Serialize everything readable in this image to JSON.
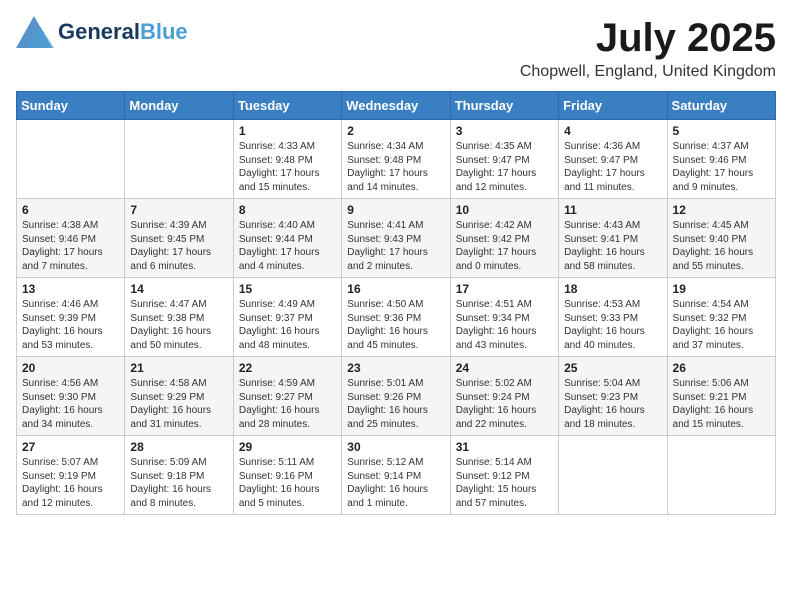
{
  "header": {
    "logo_general": "General",
    "logo_blue": "Blue",
    "month_title": "July 2025",
    "location": "Chopwell, England, United Kingdom"
  },
  "weekdays": [
    "Sunday",
    "Monday",
    "Tuesday",
    "Wednesday",
    "Thursday",
    "Friday",
    "Saturday"
  ],
  "rows": [
    [
      {
        "day": "",
        "sunrise": "",
        "sunset": "",
        "daylight": ""
      },
      {
        "day": "",
        "sunrise": "",
        "sunset": "",
        "daylight": ""
      },
      {
        "day": "1",
        "sunrise": "Sunrise: 4:33 AM",
        "sunset": "Sunset: 9:48 PM",
        "daylight": "Daylight: 17 hours and 15 minutes."
      },
      {
        "day": "2",
        "sunrise": "Sunrise: 4:34 AM",
        "sunset": "Sunset: 9:48 PM",
        "daylight": "Daylight: 17 hours and 14 minutes."
      },
      {
        "day": "3",
        "sunrise": "Sunrise: 4:35 AM",
        "sunset": "Sunset: 9:47 PM",
        "daylight": "Daylight: 17 hours and 12 minutes."
      },
      {
        "day": "4",
        "sunrise": "Sunrise: 4:36 AM",
        "sunset": "Sunset: 9:47 PM",
        "daylight": "Daylight: 17 hours and 11 minutes."
      },
      {
        "day": "5",
        "sunrise": "Sunrise: 4:37 AM",
        "sunset": "Sunset: 9:46 PM",
        "daylight": "Daylight: 17 hours and 9 minutes."
      }
    ],
    [
      {
        "day": "6",
        "sunrise": "Sunrise: 4:38 AM",
        "sunset": "Sunset: 9:46 PM",
        "daylight": "Daylight: 17 hours and 7 minutes."
      },
      {
        "day": "7",
        "sunrise": "Sunrise: 4:39 AM",
        "sunset": "Sunset: 9:45 PM",
        "daylight": "Daylight: 17 hours and 6 minutes."
      },
      {
        "day": "8",
        "sunrise": "Sunrise: 4:40 AM",
        "sunset": "Sunset: 9:44 PM",
        "daylight": "Daylight: 17 hours and 4 minutes."
      },
      {
        "day": "9",
        "sunrise": "Sunrise: 4:41 AM",
        "sunset": "Sunset: 9:43 PM",
        "daylight": "Daylight: 17 hours and 2 minutes."
      },
      {
        "day": "10",
        "sunrise": "Sunrise: 4:42 AM",
        "sunset": "Sunset: 9:42 PM",
        "daylight": "Daylight: 17 hours and 0 minutes."
      },
      {
        "day": "11",
        "sunrise": "Sunrise: 4:43 AM",
        "sunset": "Sunset: 9:41 PM",
        "daylight": "Daylight: 16 hours and 58 minutes."
      },
      {
        "day": "12",
        "sunrise": "Sunrise: 4:45 AM",
        "sunset": "Sunset: 9:40 PM",
        "daylight": "Daylight: 16 hours and 55 minutes."
      }
    ],
    [
      {
        "day": "13",
        "sunrise": "Sunrise: 4:46 AM",
        "sunset": "Sunset: 9:39 PM",
        "daylight": "Daylight: 16 hours and 53 minutes."
      },
      {
        "day": "14",
        "sunrise": "Sunrise: 4:47 AM",
        "sunset": "Sunset: 9:38 PM",
        "daylight": "Daylight: 16 hours and 50 minutes."
      },
      {
        "day": "15",
        "sunrise": "Sunrise: 4:49 AM",
        "sunset": "Sunset: 9:37 PM",
        "daylight": "Daylight: 16 hours and 48 minutes."
      },
      {
        "day": "16",
        "sunrise": "Sunrise: 4:50 AM",
        "sunset": "Sunset: 9:36 PM",
        "daylight": "Daylight: 16 hours and 45 minutes."
      },
      {
        "day": "17",
        "sunrise": "Sunrise: 4:51 AM",
        "sunset": "Sunset: 9:34 PM",
        "daylight": "Daylight: 16 hours and 43 minutes."
      },
      {
        "day": "18",
        "sunrise": "Sunrise: 4:53 AM",
        "sunset": "Sunset: 9:33 PM",
        "daylight": "Daylight: 16 hours and 40 minutes."
      },
      {
        "day": "19",
        "sunrise": "Sunrise: 4:54 AM",
        "sunset": "Sunset: 9:32 PM",
        "daylight": "Daylight: 16 hours and 37 minutes."
      }
    ],
    [
      {
        "day": "20",
        "sunrise": "Sunrise: 4:56 AM",
        "sunset": "Sunset: 9:30 PM",
        "daylight": "Daylight: 16 hours and 34 minutes."
      },
      {
        "day": "21",
        "sunrise": "Sunrise: 4:58 AM",
        "sunset": "Sunset: 9:29 PM",
        "daylight": "Daylight: 16 hours and 31 minutes."
      },
      {
        "day": "22",
        "sunrise": "Sunrise: 4:59 AM",
        "sunset": "Sunset: 9:27 PM",
        "daylight": "Daylight: 16 hours and 28 minutes."
      },
      {
        "day": "23",
        "sunrise": "Sunrise: 5:01 AM",
        "sunset": "Sunset: 9:26 PM",
        "daylight": "Daylight: 16 hours and 25 minutes."
      },
      {
        "day": "24",
        "sunrise": "Sunrise: 5:02 AM",
        "sunset": "Sunset: 9:24 PM",
        "daylight": "Daylight: 16 hours and 22 minutes."
      },
      {
        "day": "25",
        "sunrise": "Sunrise: 5:04 AM",
        "sunset": "Sunset: 9:23 PM",
        "daylight": "Daylight: 16 hours and 18 minutes."
      },
      {
        "day": "26",
        "sunrise": "Sunrise: 5:06 AM",
        "sunset": "Sunset: 9:21 PM",
        "daylight": "Daylight: 16 hours and 15 minutes."
      }
    ],
    [
      {
        "day": "27",
        "sunrise": "Sunrise: 5:07 AM",
        "sunset": "Sunset: 9:19 PM",
        "daylight": "Daylight: 16 hours and 12 minutes."
      },
      {
        "day": "28",
        "sunrise": "Sunrise: 5:09 AM",
        "sunset": "Sunset: 9:18 PM",
        "daylight": "Daylight: 16 hours and 8 minutes."
      },
      {
        "day": "29",
        "sunrise": "Sunrise: 5:11 AM",
        "sunset": "Sunset: 9:16 PM",
        "daylight": "Daylight: 16 hours and 5 minutes."
      },
      {
        "day": "30",
        "sunrise": "Sunrise: 5:12 AM",
        "sunset": "Sunset: 9:14 PM",
        "daylight": "Daylight: 16 hours and 1 minute."
      },
      {
        "day": "31",
        "sunrise": "Sunrise: 5:14 AM",
        "sunset": "Sunset: 9:12 PM",
        "daylight": "Daylight: 15 hours and 57 minutes."
      },
      {
        "day": "",
        "sunrise": "",
        "sunset": "",
        "daylight": ""
      },
      {
        "day": "",
        "sunrise": "",
        "sunset": "",
        "daylight": ""
      }
    ]
  ]
}
